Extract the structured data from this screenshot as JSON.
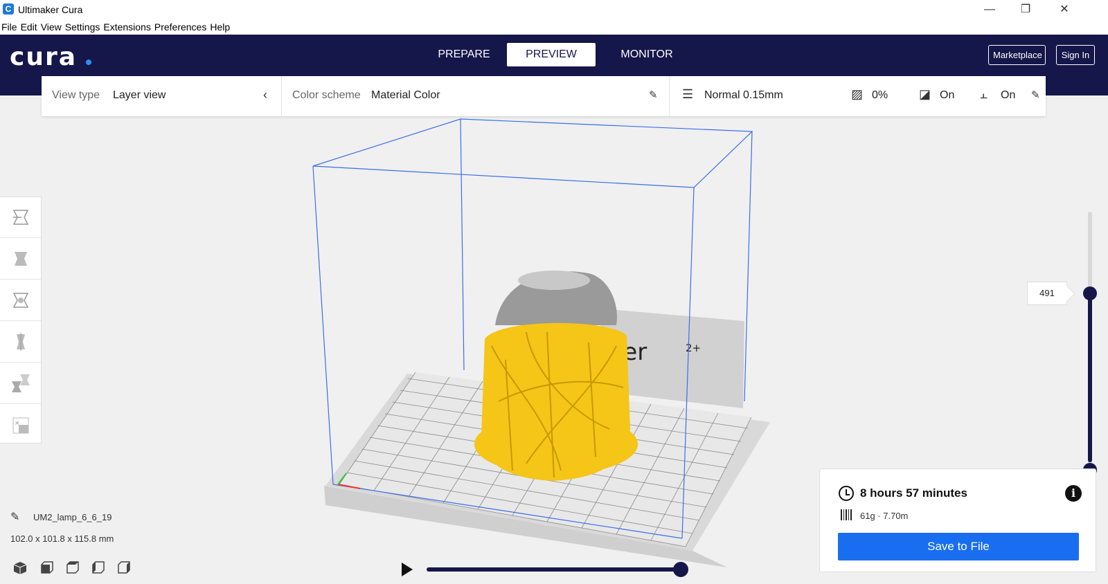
{
  "window": {
    "title": "Ultimaker Cura",
    "app_icon_letter": "C",
    "minimize": "—",
    "maximize": "❐",
    "close": "✕"
  },
  "menu": [
    "File",
    "Edit",
    "View",
    "Settings",
    "Extensions",
    "Preferences",
    "Help"
  ],
  "header": {
    "logo": "cura",
    "stages": [
      "PREPARE",
      "PREVIEW",
      "MONITOR"
    ],
    "active_stage": "PREVIEW",
    "marketplace": "Marketplace",
    "sign_in": "Sign In"
  },
  "topbar": {
    "view_type_label": "View type",
    "view_type_value": "Layer view",
    "color_scheme_label": "Color scheme",
    "color_scheme_value": "Material Color",
    "profile": "Normal 0.15mm",
    "infill": "0%",
    "support": "On",
    "adhesion": "On"
  },
  "viewport": {
    "build_plate_logo": "ultimaker",
    "build_plate_logo_visible": "aker",
    "printer_suffix": "2+",
    "model_color": "#f5c518",
    "volume_color": "#3a6ee8"
  },
  "toolbar": {
    "tools": [
      "move-tool",
      "scale-tool",
      "rotate-tool",
      "mirror-tool",
      "per-model-settings-tool",
      "support-blocker-tool"
    ]
  },
  "layer_slider": {
    "current_layer": "491"
  },
  "model": {
    "name": "UM2_lamp_6_6_19",
    "dimensions": "102.0 x 101.8 x 115.8 mm"
  },
  "camera_views": [
    "3d-view",
    "front-view",
    "top-view",
    "left-view",
    "right-view"
  ],
  "print_info": {
    "time": "8 hours 57 minutes",
    "material": "61g · 7.70m",
    "save_label": "Save to File"
  },
  "colors": {
    "header_bg": "#15164a",
    "accent": "#196ef0"
  }
}
